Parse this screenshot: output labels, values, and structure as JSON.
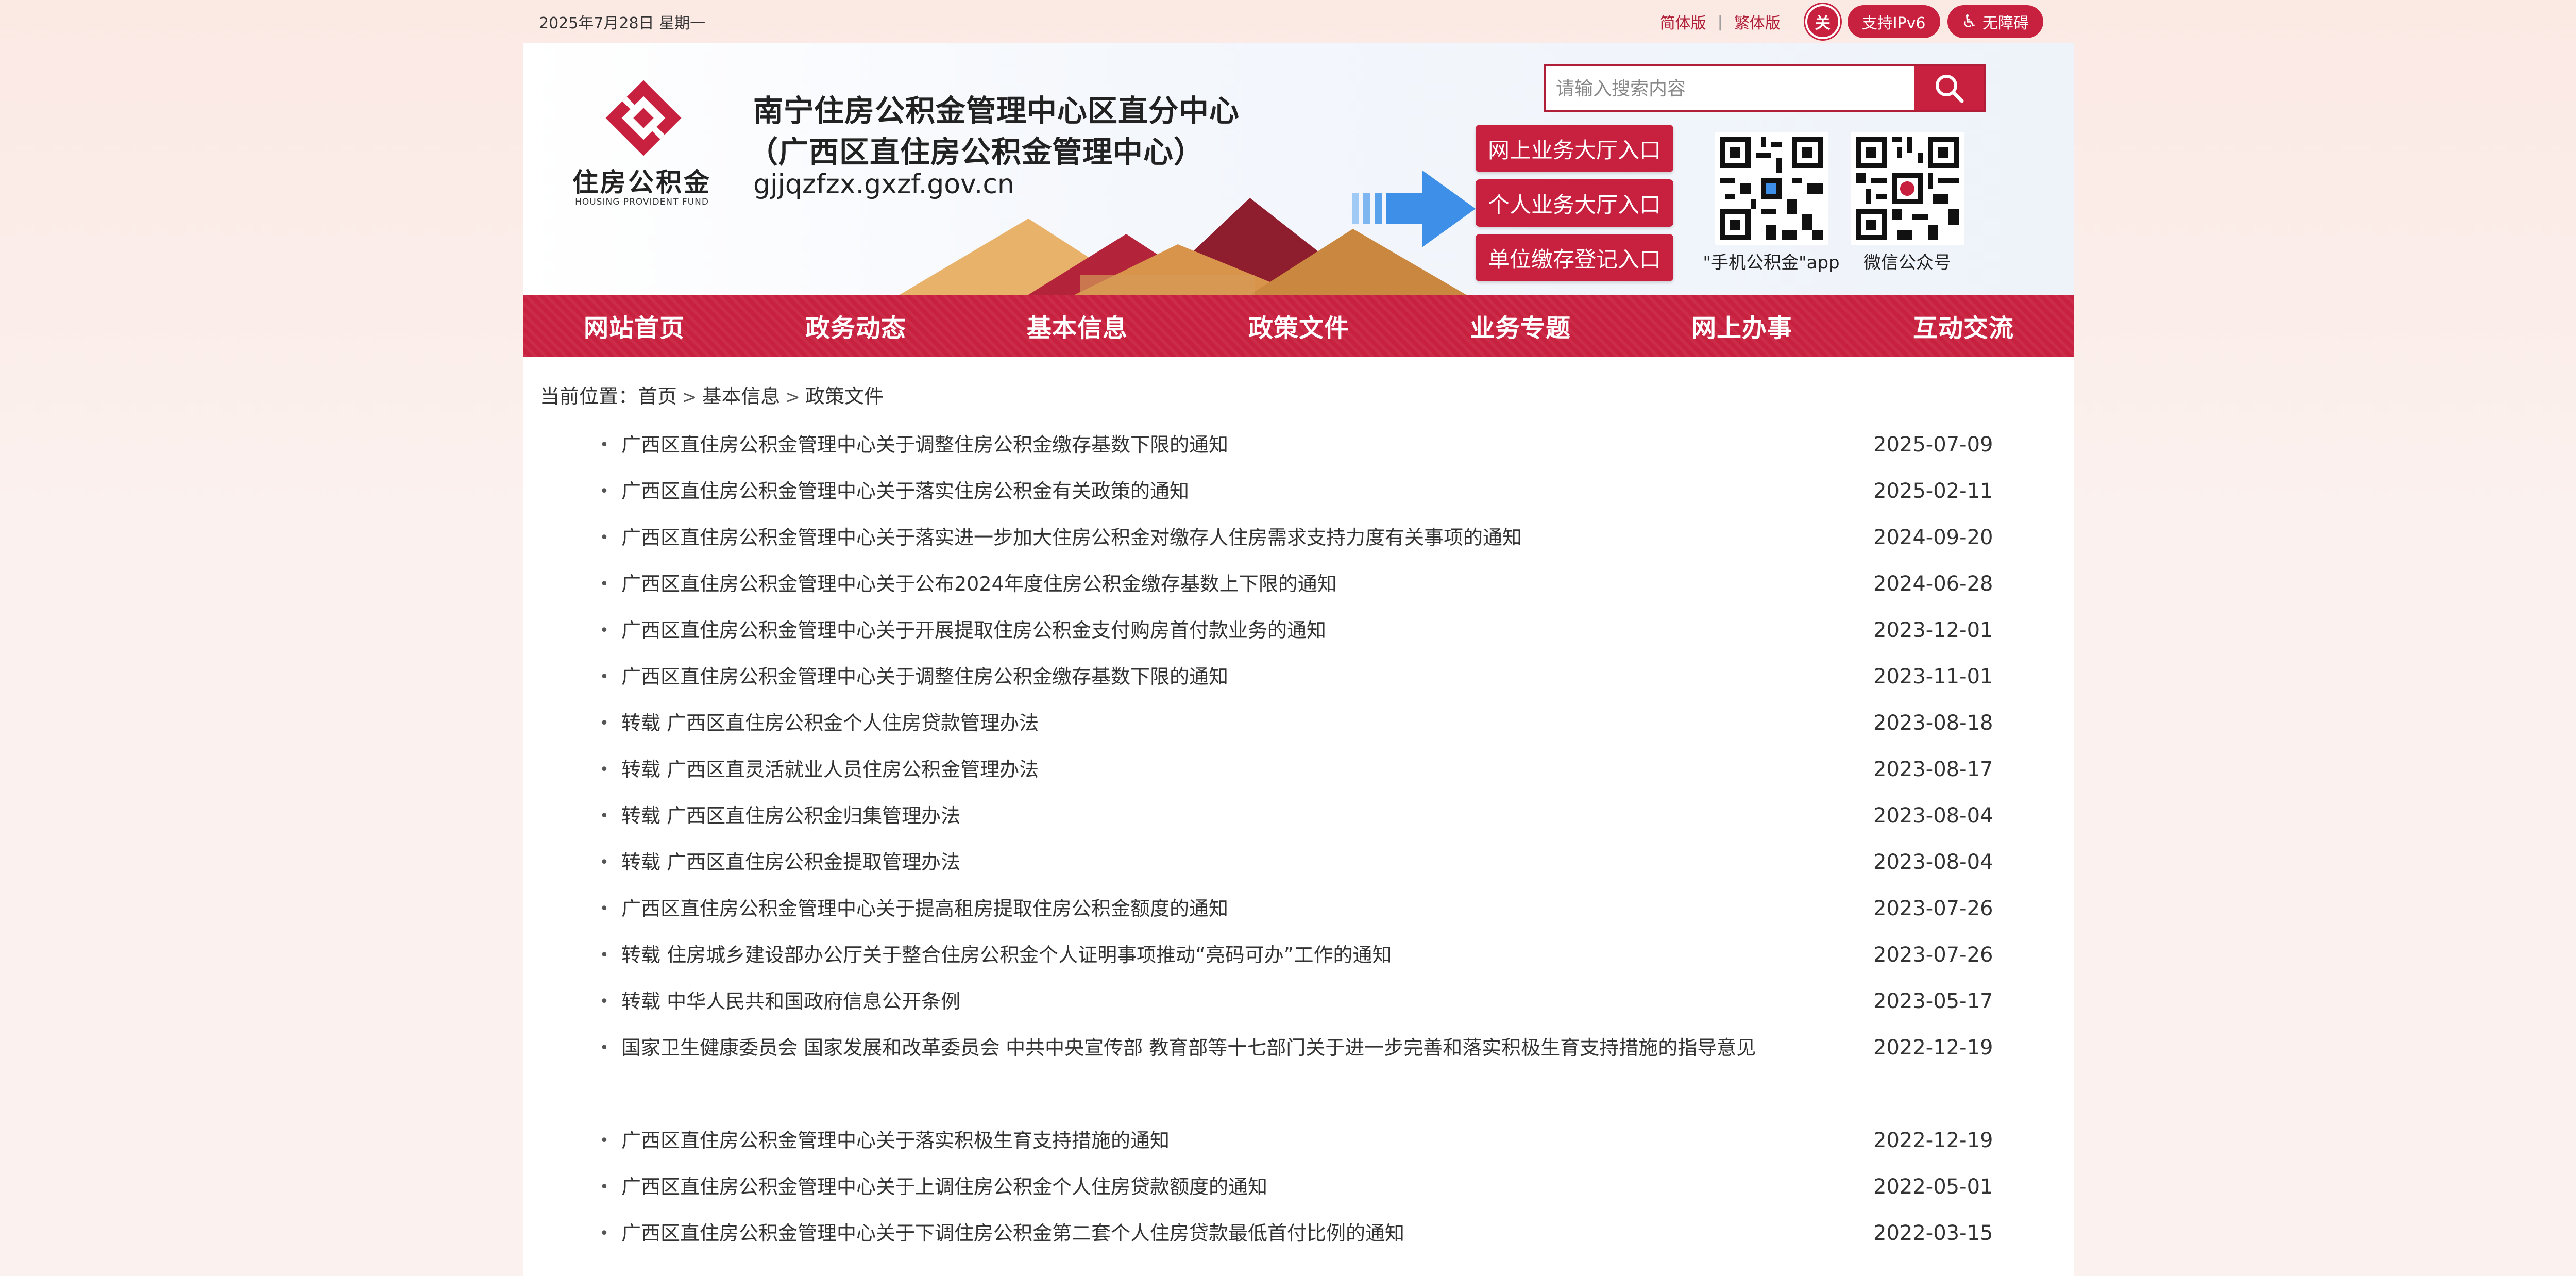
{
  "topbar": {
    "date": "2025年7月28日  星期一",
    "simplified": "简体版",
    "separator": "|",
    "traditional": "繁体版",
    "care_badge": "关",
    "ipv6": "支持IPv6",
    "accessibility_symbol": "♿",
    "accessibility": "无障碍"
  },
  "header": {
    "logo_cn": "住房公积金",
    "logo_en": "HOUSING PROVIDENT FUND",
    "title_line1": "南宁住房公积金管理中心区直分中心",
    "title_line2": "（广西区直住房公积金管理中心）",
    "domain": "gjjqzfzx.gxzf.gov.cn",
    "entries": [
      "网上业务大厅入口",
      "个人业务大厅入口",
      "单位缴存登记入口"
    ],
    "search_placeholder": "请输入搜索内容",
    "qr_labels": [
      "\"手机公积金\"app",
      "微信公众号"
    ]
  },
  "nav": {
    "items": [
      "网站首页",
      "政务动态",
      "基本信息",
      "政策文件",
      "业务专题",
      "网上办事",
      "互动交流"
    ]
  },
  "breadcrumb": {
    "prefix": "当前位置：",
    "crumbs": [
      "首页",
      "基本信息",
      "政策文件"
    ],
    "separator": ">"
  },
  "list": [
    {
      "title": "广西区直住房公积金管理中心关于调整住房公积金缴存基数下限的通知",
      "date": "2025-07-09"
    },
    {
      "title": "广西区直住房公积金管理中心关于落实住房公积金有关政策的通知",
      "date": "2025-02-11"
    },
    {
      "title": "广西区直住房公积金管理中心关于落实进一步加大住房公积金对缴存人住房需求支持力度有关事项的通知",
      "date": "2024-09-20"
    },
    {
      "title": "广西区直住房公积金管理中心关于公布2024年度住房公积金缴存基数上下限的通知",
      "date": "2024-06-28"
    },
    {
      "title": "广西区直住房公积金管理中心关于开展提取住房公积金支付购房首付款业务的通知",
      "date": "2023-12-01"
    },
    {
      "title": "广西区直住房公积金管理中心关于调整住房公积金缴存基数下限的通知",
      "date": "2023-11-01"
    },
    {
      "title": "转载 广西区直住房公积金个人住房贷款管理办法",
      "date": "2023-08-18"
    },
    {
      "title": "转载 广西区直灵活就业人员住房公积金管理办法",
      "date": "2023-08-17"
    },
    {
      "title": "转载 广西区直住房公积金归集管理办法",
      "date": "2023-08-04"
    },
    {
      "title": "转载 广西区直住房公积金提取管理办法",
      "date": "2023-08-04"
    },
    {
      "title": "广西区直住房公积金管理中心关于提高租房提取住房公积金额度的通知",
      "date": "2023-07-26"
    },
    {
      "title": "转载 住房城乡建设部办公厅关于整合住房公积金个人证明事项推动“亮码可办”工作的通知",
      "date": "2023-07-26"
    },
    {
      "title": "转载 中华人民共和国政府信息公开条例",
      "date": "2023-05-17"
    },
    {
      "title": "国家卫生健康委员会 国家发展和改革委员会 中共中央宣传部 教育部等十七部门关于进一步完善和落实积极生育支持措施的指导意见",
      "date": "2022-12-19"
    },
    {
      "title": "广西区直住房公积金管理中心关于落实积极生育支持措施的通知",
      "date": "2022-12-19"
    },
    {
      "title": "广西区直住房公积金管理中心关于上调住房公积金个人住房贷款额度的通知",
      "date": "2022-05-01"
    },
    {
      "title": "广西区直住房公积金管理中心关于下调住房公积金第二套个人住房贷款最低首付比例的通知",
      "date": "2022-03-15"
    }
  ],
  "colors": {
    "brand_red": "#c8213f",
    "page_bg": "#fbeeea",
    "arrow_blue": "#3d8fe8"
  }
}
